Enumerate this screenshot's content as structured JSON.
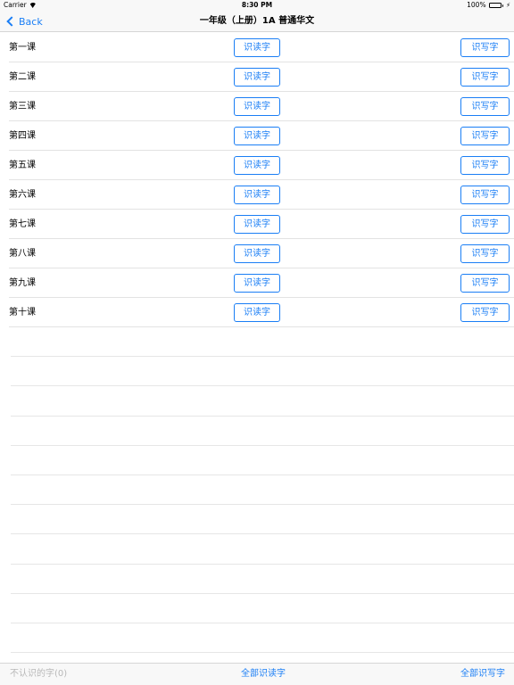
{
  "status_bar": {
    "carrier": "Carrier",
    "time": "8:30 PM",
    "battery": "100%",
    "icons": {
      "wifi": "wifi-icon",
      "battery": "battery-icon",
      "charging": "charging-icon"
    }
  },
  "nav": {
    "back_label": "Back",
    "title": "一年级（上册）1A 普通华文",
    "icons": {
      "back": "chevron-left-icon"
    }
  },
  "lessons": [
    {
      "title": "第一课",
      "read_label": "识读字",
      "write_label": "识写字"
    },
    {
      "title": "第二课",
      "read_label": "识读字",
      "write_label": "识写字"
    },
    {
      "title": "第三课",
      "read_label": "识读字",
      "write_label": "识写字"
    },
    {
      "title": "第四课",
      "read_label": "识读字",
      "write_label": "识写字"
    },
    {
      "title": "第五课",
      "read_label": "识读字",
      "write_label": "识写字"
    },
    {
      "title": "第六课",
      "read_label": "识读字",
      "write_label": "识写字"
    },
    {
      "title": "第七课",
      "read_label": "识读字",
      "write_label": "识写字"
    },
    {
      "title": "第八课",
      "read_label": "识读字",
      "write_label": "识写字"
    },
    {
      "title": "第九课",
      "read_label": "识读字",
      "write_label": "识写字"
    },
    {
      "title": "第十课",
      "read_label": "识读字",
      "write_label": "识写字"
    }
  ],
  "toolbar": {
    "unknown_label": "不认识的字(0)",
    "all_read_label": "全部识读字",
    "all_write_label": "全部识写字"
  },
  "colors": {
    "accent": "#1a7ef5",
    "disabled": "#b8b8b8",
    "battery": "#4cd964",
    "bar_background": "#f8f8f8"
  }
}
